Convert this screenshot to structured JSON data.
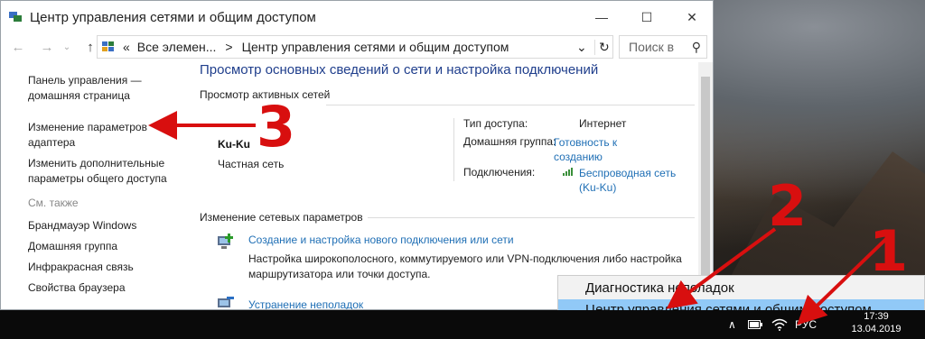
{
  "window": {
    "title": "Центр управления сетями и общим доступом",
    "controls": {
      "minimize": "—",
      "maximize": "☐",
      "close": "✕"
    }
  },
  "address": {
    "back": "←",
    "forward": "→",
    "up": "↑",
    "chevron": "«",
    "crumb1": "Все элемен...",
    "sep": ">",
    "crumb2": "Центр управления сетями и общим доступом",
    "dropdown": "⌄",
    "refresh": "↻",
    "search_placeholder": "Поиск в",
    "search_icon": "⚲"
  },
  "left_pane": {
    "home_line1": "Панель управления —",
    "home_line2": "домашняя страница",
    "adapter_line1": "Изменение параметров",
    "adapter_line2": "адаптера",
    "sharing_line1": "Изменить дополнительные",
    "sharing_line2": "параметры общего доступа",
    "see_also": "См. также",
    "links": [
      "Брандмауэр Windows",
      "Домашняя группа",
      "Инфракрасная связь",
      "Свойства браузера"
    ]
  },
  "main": {
    "heading": "Просмотр основных сведений о сети и настройка подключений",
    "active_networks": "Просмотр активных сетей",
    "network_name": "Ku-Ku",
    "network_type": "Частная сеть",
    "access_type_label": "Тип доступа:",
    "access_type_value": "Интернет",
    "homegroup_label": "Домашняя группа:",
    "homegroup_value1": "Готовность к",
    "homegroup_value2": "созданию",
    "connections_label": "Подключения:",
    "connections_value1": "Беспроводная сеть",
    "connections_value2": "(Ku-Ku)",
    "change_settings": "Изменение сетевых параметров",
    "task1_link": "Создание и настройка нового подключения или сети",
    "task1_desc1": "Настройка широкополосного, коммутируемого или VPN-подключения либо настройка",
    "task1_desc2": "маршрутизатора или точки доступа.",
    "task2_link": "Устранение неполадок"
  },
  "context_menu": {
    "items": [
      "Диагностика неполадок",
      "Центр управления сетями и общим доступом"
    ],
    "selected_index": 1
  },
  "taskbar": {
    "chevron": "∧",
    "language": "РУС",
    "time": "17:39",
    "date": "13.04.2019"
  },
  "annotations": {
    "n1": "1",
    "n2": "2",
    "n3": "3",
    "color": "#d80f0f"
  },
  "icons": [
    "window-network-icon",
    "control-panel-icon",
    "wifi-icon",
    "battery-icon",
    "new-connection-icon",
    "troubleshoot-icon"
  ]
}
